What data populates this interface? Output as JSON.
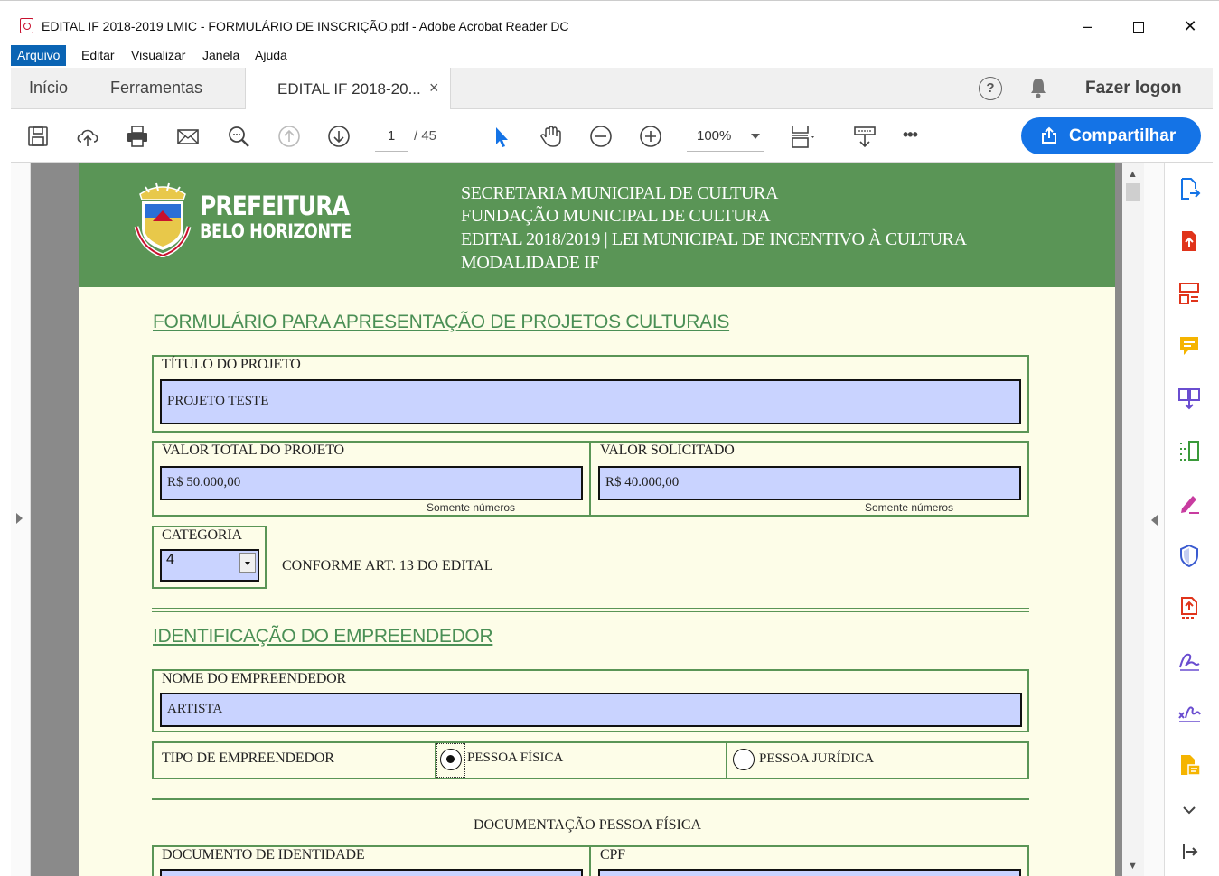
{
  "window": {
    "title": "EDITAL IF 2018-2019 LMIC - FORMULÁRIO DE INSCRIÇÃO.pdf - Adobe Acrobat Reader DC",
    "minimize": "–",
    "close": "✕"
  },
  "menu": {
    "items": [
      "Arquivo",
      "Editar",
      "Visualizar",
      "Janela",
      "Ajuda"
    ]
  },
  "tabs": {
    "home": "Início",
    "tools": "Ferramentas",
    "document": "EDITAL IF 2018-20...",
    "close": "×",
    "help": "?",
    "login": "Fazer logon"
  },
  "toolbar": {
    "page_current": "1",
    "page_total": "/ 45",
    "zoom": "100%",
    "more": "•••",
    "share_label": "Compartilhar"
  },
  "document": {
    "banner": {
      "logo_title": "PREFEITURA",
      "logo_subtitle": "BELO HORIZONTE",
      "line1": "SECRETARIA MUNICIPAL DE CULTURA",
      "line2": "FUNDAÇÃO MUNICIPAL DE CULTURA",
      "line3": "EDITAL 2018/2019 | LEI MUNICIPAL DE INCENTIVO À CULTURA",
      "line4": "MODALIDADE IF"
    },
    "form_heading": "FORMULÁRIO PARA APRESENTAÇÃO DE PROJETOS CULTURAIS",
    "project_title": {
      "label": "TÍTULO DO PROJETO",
      "value": "PROJETO TESTE"
    },
    "total_value": {
      "label": "VALOR TOTAL DO PROJETO",
      "value": "R$ 50.000,00",
      "hint": "Somente números"
    },
    "requested_value": {
      "label": "VALOR SOLICITADO",
      "value": "R$ 40.000,00",
      "hint": "Somente números"
    },
    "category": {
      "label": "CATEGORIA",
      "value": "4",
      "note": "CONFORME ART. 13 DO EDITAL"
    },
    "entrepreneur_heading": "IDENTIFICAÇÃO DO EMPREENDEDOR",
    "entrepreneur_name": {
      "label": "NOME DO EMPREENDEDOR",
      "value": "ARTISTA"
    },
    "entrepreneur_type": {
      "label": "TIPO DE EMPREENDEDOR",
      "options": [
        "PESSOA FÍSICA",
        "PESSOA JURÍDICA"
      ],
      "selected": "PESSOA FÍSICA"
    },
    "docs_heading": "DOCUMENTAÇÃO PESSOA FÍSICA",
    "identity_doc": {
      "label": "DOCUMENTO DE IDENTIDADE"
    },
    "cpf": {
      "label": "CPF"
    }
  },
  "colors": {
    "banner_green": "#5a9556",
    "page_bg": "#fdfde8",
    "field_bg": "#c9d3ff",
    "share_blue": "#1473e6",
    "menu_active": "#0a64b4"
  },
  "icons": {
    "toolbar": [
      "save-icon",
      "upload-icon",
      "print-icon",
      "email-icon",
      "search-icon",
      "prev-page-icon",
      "next-page-icon",
      "select-cursor-icon",
      "hand-icon",
      "zoom-out-icon",
      "zoom-in-icon",
      "fit-page-icon",
      "scroll-mode-icon",
      "more-icon"
    ],
    "tools_rail": [
      "export-pdf-icon",
      "create-pdf-icon",
      "organize-pages-icon",
      "comment-icon",
      "combine-files-icon",
      "edit-pdf-icon",
      "fill-sign-icon",
      "protect-icon",
      "send-for-review-icon",
      "sign-icon",
      "certificate-icon",
      "more-tools-icon",
      "expand-icon",
      "collapse-panel-icon"
    ]
  }
}
